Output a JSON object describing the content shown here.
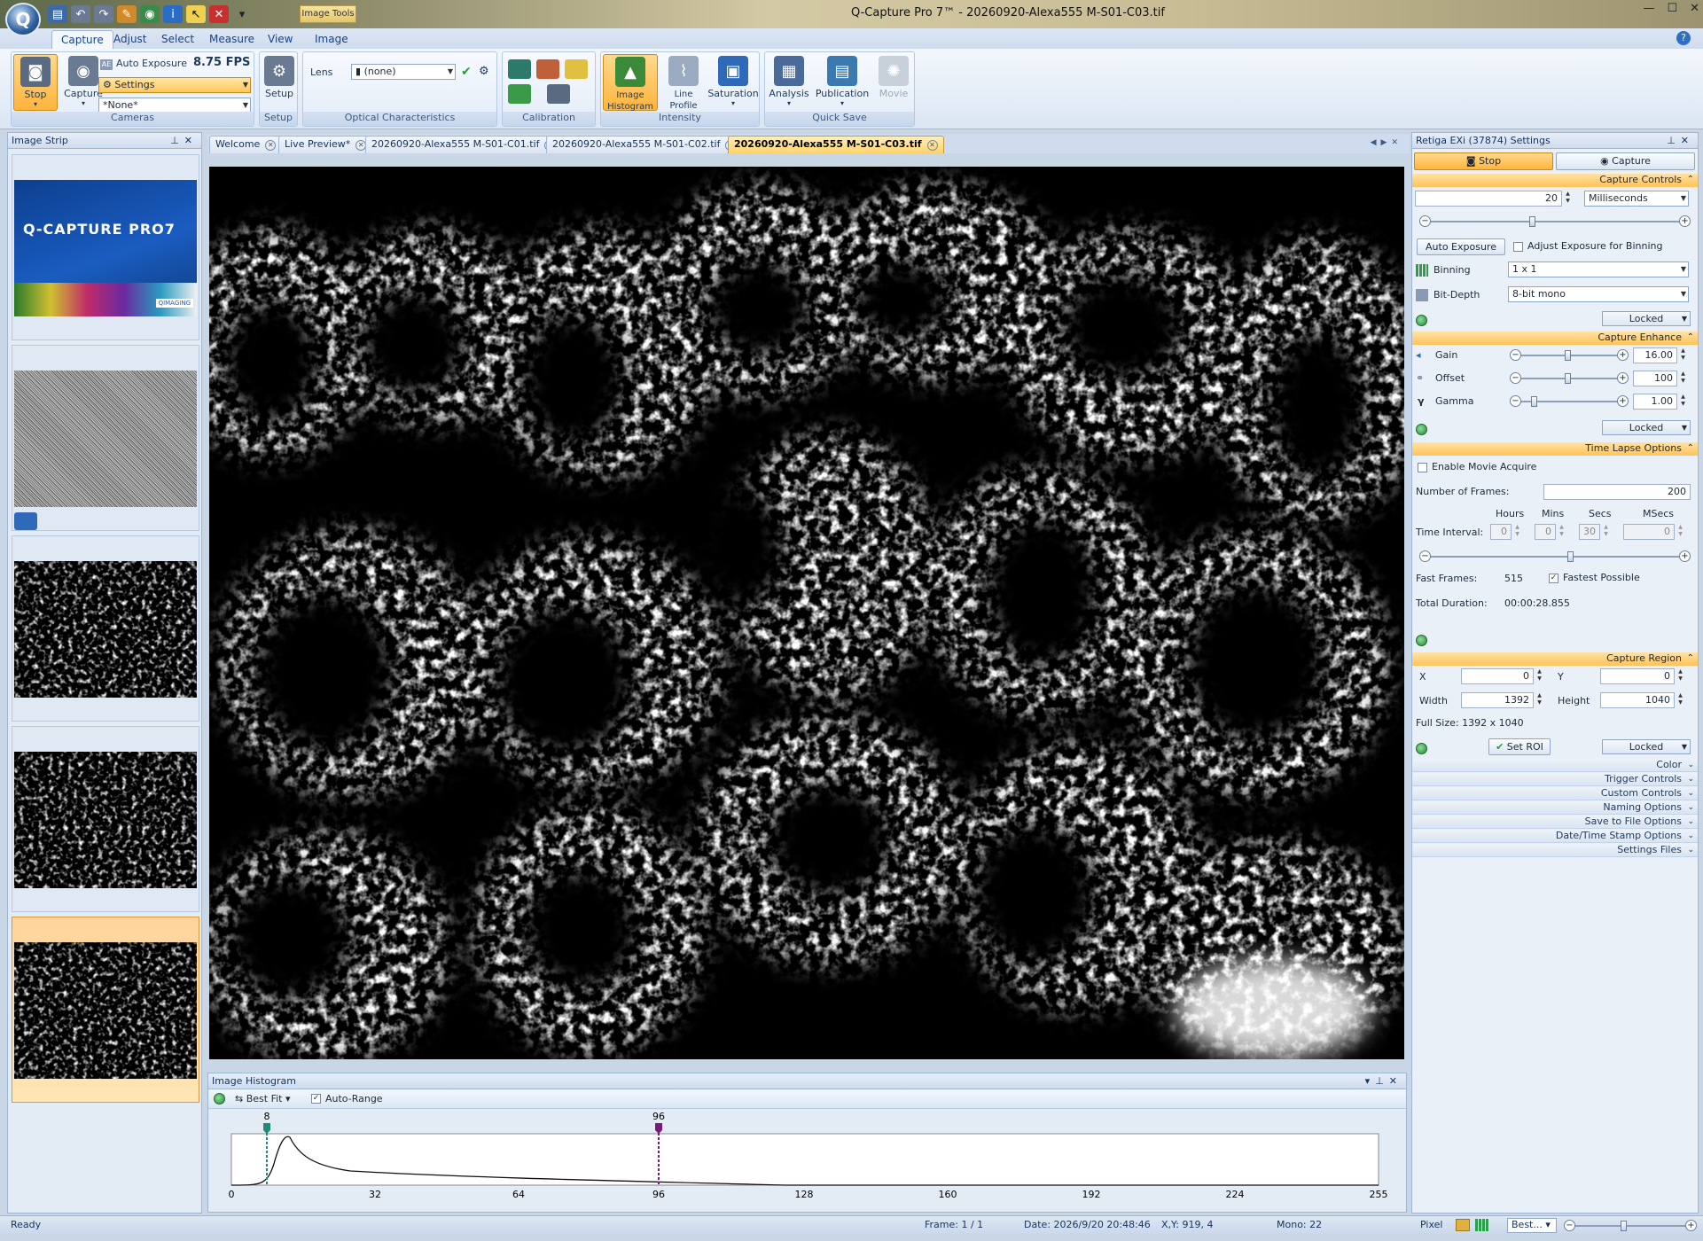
{
  "app": {
    "title": "Q-Capture Pro 7™ - 20260920-Alexa555 M-S01-C03.tif",
    "contextual_tab": "Image Tools",
    "logo_letter": "Q"
  },
  "ribbon_tabs": [
    "Capture",
    "Adjust",
    "Select",
    "Measure",
    "View",
    "Image"
  ],
  "ribbon": {
    "cameras": {
      "group_label": "Cameras",
      "stop_label": "Stop",
      "capture_label": "Capture",
      "auto_exposure_label": "Auto Exposure",
      "fps": "8.75 FPS",
      "settings_label": "Settings",
      "preset_value": "*None*"
    },
    "setup": {
      "group_label": "Setup",
      "setup_label": "Setup"
    },
    "optical": {
      "group_label": "Optical Characteristics",
      "lens_label": "Lens",
      "lens_value": "(none)"
    },
    "calibration": {
      "group_label": "Calibration"
    },
    "intensity": {
      "group_label": "Intensity",
      "histogram_label": "Image Histogram",
      "line_profile_label": "Line Profile",
      "saturation_label": "Saturation"
    },
    "quick_save": {
      "group_label": "Quick Save",
      "analysis_label": "Analysis",
      "publication_label": "Publication",
      "movie_label": "Movie"
    }
  },
  "image_strip": {
    "title": "Image Strip",
    "splash_text": "Q-CAPTURE PRO7",
    "splash_brand": "QIMAGING"
  },
  "doc_tabs": [
    "Welcome",
    "Live Preview*",
    "20260920-Alexa555 M-S01-C01.tif",
    "20260920-Alexa555 M-S01-C02.tif",
    "20260920-Alexa555 M-S01-C03.tif"
  ],
  "histogram": {
    "title": "Image Histogram",
    "best_fit_label": "Best Fit",
    "auto_range_label": "Auto-Range",
    "marker_low": "8",
    "marker_high": "96",
    "ticks": [
      "0",
      "32",
      "64",
      "96",
      "128",
      "160",
      "192",
      "224",
      "255"
    ]
  },
  "settings_panel": {
    "title": "Retiga EXi (37874) Settings",
    "stop_label": "Stop",
    "capture_label": "Capture",
    "capture_controls": {
      "header": "Capture Controls",
      "exposure_value": "20",
      "exposure_unit": "Milliseconds",
      "auto_exposure_btn": "Auto Exposure",
      "adjust_binning_label": "Adjust Exposure for Binning",
      "binning_label": "Binning",
      "binning_value": "1 x 1",
      "bitdepth_label": "Bit-Depth",
      "bitdepth_value": "8-bit mono",
      "locked": "Locked"
    },
    "capture_enhance": {
      "header": "Capture Enhance",
      "gain_label": "Gain",
      "gain_value": "16.00",
      "offset_label": "Offset",
      "offset_value": "100",
      "gamma_label": "Gamma",
      "gamma_value": "1.00",
      "locked": "Locked"
    },
    "time_lapse": {
      "header": "Time Lapse Options",
      "enable_movie_label": "Enable Movie Acquire",
      "frames_label": "Number of Frames:",
      "frames_value": "200",
      "hours_label": "Hours",
      "mins_label": "Mins",
      "secs_label": "Secs",
      "msecs_label": "MSecs",
      "interval_label": "Time Interval:",
      "hours_value": "0",
      "mins_value": "0",
      "secs_value": "30",
      "msecs_value": "0",
      "fast_frames_label": "Fast Frames:",
      "fast_frames_value": "515",
      "fastest_label": "Fastest Possible",
      "total_duration_label": "Total Duration:",
      "total_duration_value": "00:00:28.855"
    },
    "capture_region": {
      "header": "Capture Region",
      "x_label": "X",
      "x_value": "0",
      "y_label": "Y",
      "y_value": "0",
      "width_label": "Width",
      "width_value": "1392",
      "height_label": "Height",
      "height_value": "1040",
      "full_size": "Full Size: 1392 x 1040",
      "set_roi_label": "Set ROI",
      "locked": "Locked"
    },
    "collapsed_sections": [
      "Color",
      "Trigger Controls",
      "Custom Controls",
      "Naming Options",
      "Save to File Options",
      "Date/Time Stamp Options",
      "Settings Files"
    ]
  },
  "statusbar": {
    "status": "Ready",
    "frame": "Frame: 1 / 1",
    "date": "Date: 2026/9/20 20:48:46",
    "xy": "X,Y:  919,    4",
    "mono": "Mono:    22",
    "pixel": "Pixel",
    "zoom_mode": "Best..."
  },
  "colors": {
    "accent_orange": "#ffc35a",
    "ribbon_blue": "#dbe6f4",
    "marker_low": "#1f8a7a",
    "marker_high": "#7a1a7a"
  }
}
